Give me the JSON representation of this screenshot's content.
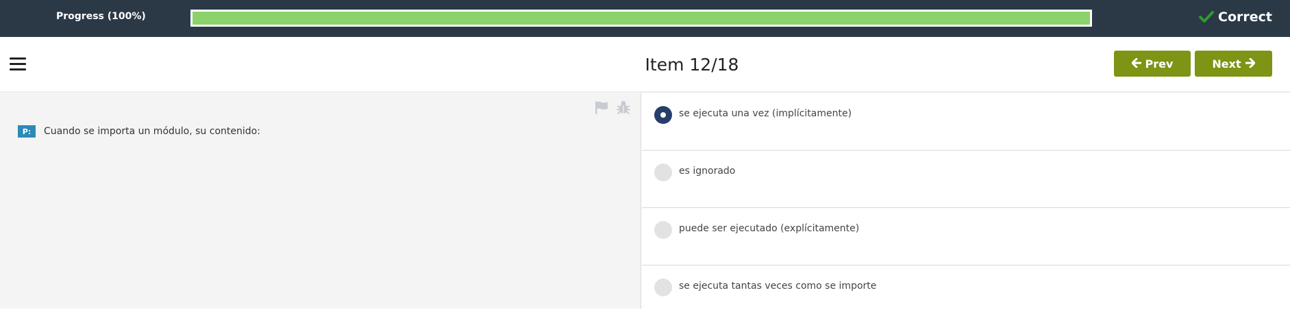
{
  "progress": {
    "label": "Progress (100%)",
    "value": 1.0,
    "fill_color": "#8cd26c"
  },
  "status": {
    "icon": "checkmark-icon",
    "label": "Correct",
    "color": "#2e9b2e"
  },
  "header": {
    "menu_icon": "hamburger-menu-icon",
    "title": "Item 12/18",
    "prev_label": "Prev",
    "prev_icon": "arrow-left-icon",
    "next_label": "Next",
    "next_icon": "arrow-right-icon",
    "button_color": "#7d9414"
  },
  "question": {
    "badge": "P:",
    "text": "Cuando se importa un módulo, su contenido:",
    "tools": [
      "flag-icon",
      "bug-icon"
    ]
  },
  "options": [
    {
      "label": "se ejecuta una vez (implícitamente)",
      "selected": true
    },
    {
      "label": "es ignorado",
      "selected": false
    },
    {
      "label": "puede ser ejecutado (explícitamente)",
      "selected": false
    },
    {
      "label": "se ejecuta tantas veces como se importe",
      "selected": false
    }
  ]
}
